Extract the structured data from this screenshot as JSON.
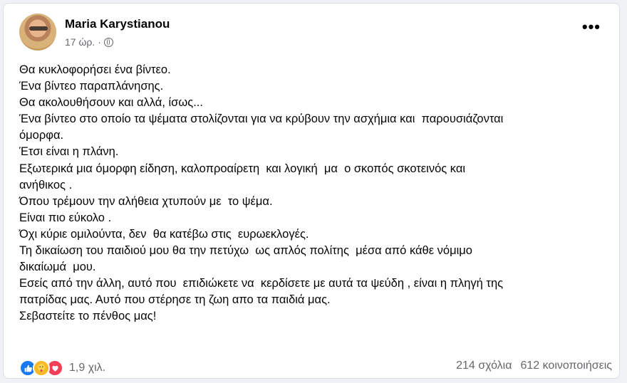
{
  "post": {
    "author": "Maria Karystianou",
    "time": "17 ώρ.",
    "separator": "·",
    "privacy_icon": "globe-icon",
    "more_label": "•••",
    "lines": [
      "Θα κυκλοφορήσει ένα βίντεο.",
      "Ένα βίντεο παραπλάνησης.",
      "Θα ακολουθήσουν και αλλά, ίσως...",
      "Ένα βίντεο στο οποίο τα ψέματα στολίζονται για να κρύβουν την ασχήμια και  παρουσιάζονται",
      "όμορφα.",
      "Έτσι είναι η πλάνη.",
      "Εξωτερικά μια όμορφη είδηση, καλοπροαίρετη  και λογική  μα  ο σκοπός σκοτεινός και",
      "ανήθικος .",
      "Όπου τρέμουν την αλήθεια χτυπούν με  το ψέμα.",
      "Είναι πιο εύκολο .",
      "Όχι κύριε ομιλούντα, δεν  θα κατέβω στις  ευρωεκλογές.",
      "Τη δικαίωση του παιδιού μου θα την πετύχω  ως απλός πολίτης  μέσα από κάθε νόμιμο",
      "δικαίωμά  μου.",
      "Εσείς από την άλλη, αυτό που  επιδιώκετε να  κερδίσετε με αυτά τα ψεύδη , είναι η πληγή της",
      "πατρίδας μας. Αυτό που στέρησε τη ζωη απο τα παιδιά μας.",
      "Σεβαστείτε το πένθος μας!"
    ],
    "reactions": {
      "icons": [
        "like-icon",
        "care-icon",
        "love-icon"
      ],
      "count": "1,9 χιλ."
    },
    "comments": "214 σχόλια",
    "shares": "612 κοινοποιήσεις"
  },
  "colors": {
    "background": "#f0f2f5",
    "card": "#ffffff",
    "text": "#050505",
    "secondary_text": "#65676b",
    "like": "#1877f2",
    "care": "#f7b928",
    "love": "#f33e58"
  }
}
